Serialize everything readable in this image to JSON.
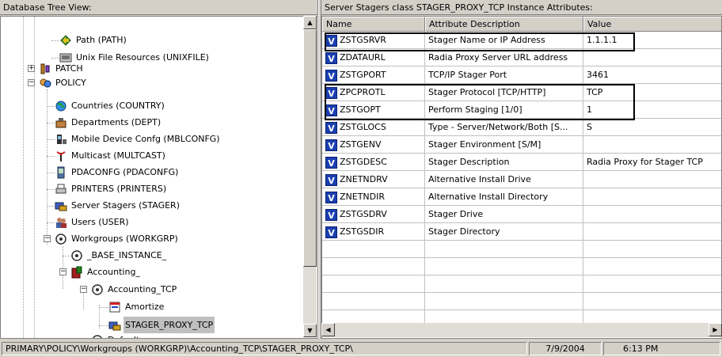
{
  "left_header": "Database Tree View:",
  "right_header": "Server Stagers class STAGER_PROXY_TCP Instance Attributes:",
  "tree": {
    "items": [
      {
        "label": "Path (PATH)",
        "icon": "path-icon"
      },
      {
        "label": "Unix File Resources (UNIXFILE)",
        "icon": "unixfile-icon"
      },
      {
        "label": "PATCH",
        "icon": "patch-icon"
      },
      {
        "label": "POLICY",
        "icon": "policy-icon"
      },
      {
        "label": "Countries (COUNTRY)",
        "icon": "globe-icon"
      },
      {
        "label": "Departments (DEPT)",
        "icon": "departments-icon"
      },
      {
        "label": "Mobile Device Confg (MBLCONFG)",
        "icon": "mobile-device-icon"
      },
      {
        "label": "Multicast (MULTCAST)",
        "icon": "antenna-icon"
      },
      {
        "label": "PDACONFG (PDACONFG)",
        "icon": "pda-icon"
      },
      {
        "label": "PRINTERS (PRINTERS)",
        "icon": "printer-icon"
      },
      {
        "label": "Server Stagers (STAGER)",
        "icon": "server-stager-icon"
      },
      {
        "label": "Users (USER)",
        "icon": "users-icon"
      },
      {
        "label": "Workgroups (WORKGRP)",
        "icon": "workgroup-icon"
      },
      {
        "label": "_BASE_INSTANCE_",
        "icon": "instance-icon"
      },
      {
        "label": "Accounting_",
        "icon": "accounting-icon"
      },
      {
        "label": "Accounting_TCP",
        "icon": "workgroup-icon"
      },
      {
        "label": "Amortize",
        "icon": "amortize-icon"
      },
      {
        "label": "STAGER_PROXY_TCP",
        "icon": "server-stager-icon"
      },
      {
        "label": "Default",
        "icon": "instance-icon"
      }
    ]
  },
  "grid": {
    "columns": [
      "Name",
      "Attribute Description",
      "Value"
    ],
    "rows": [
      {
        "name": "ZSTGSRVR",
        "desc": "Stager Name or IP Address",
        "value": "1.1.1.1"
      },
      {
        "name": "ZDATAURL",
        "desc": "Radia Proxy Server URL address",
        "value": ""
      },
      {
        "name": "ZSTGPORT",
        "desc": "TCP/IP Stager Port",
        "value": "3461"
      },
      {
        "name": "ZPCPROTL",
        "desc": "Stager Protocol [TCP/HTTP]",
        "value": "TCP"
      },
      {
        "name": "ZSTGOPT",
        "desc": "Perform Staging [1/0]",
        "value": "1"
      },
      {
        "name": "ZSTGLOCS",
        "desc": "Type - Server/Network/Both [S...",
        "value": "S"
      },
      {
        "name": "ZSTGENV",
        "desc": "Stager Environment [S/M]",
        "value": ""
      },
      {
        "name": "ZSTGDESC",
        "desc": "Stager Description",
        "value": "Radia Proxy for Stager TCP"
      },
      {
        "name": "ZNETNDRV",
        "desc": "Alternative Install Drive",
        "value": ""
      },
      {
        "name": "ZNETNDIR",
        "desc": "Alternative Install Directory",
        "value": ""
      },
      {
        "name": "ZSTGSDRV",
        "desc": "Stager Drive",
        "value": ""
      },
      {
        "name": "ZSTGSDIR",
        "desc": "Stager Directory",
        "value": ""
      }
    ],
    "row_icon": "V"
  },
  "status": {
    "path": "PRIMARY\\POLICY\\Workgroups (WORKGRP)\\Accounting_TCP\\STAGER_PROXY_TCP\\",
    "date": "7/9/2004",
    "time": "6:13 PM"
  },
  "colors": {
    "chrome": "#d4d0c8",
    "icon_blue": "#1a3fb0",
    "selection": "#c0c0c0"
  }
}
